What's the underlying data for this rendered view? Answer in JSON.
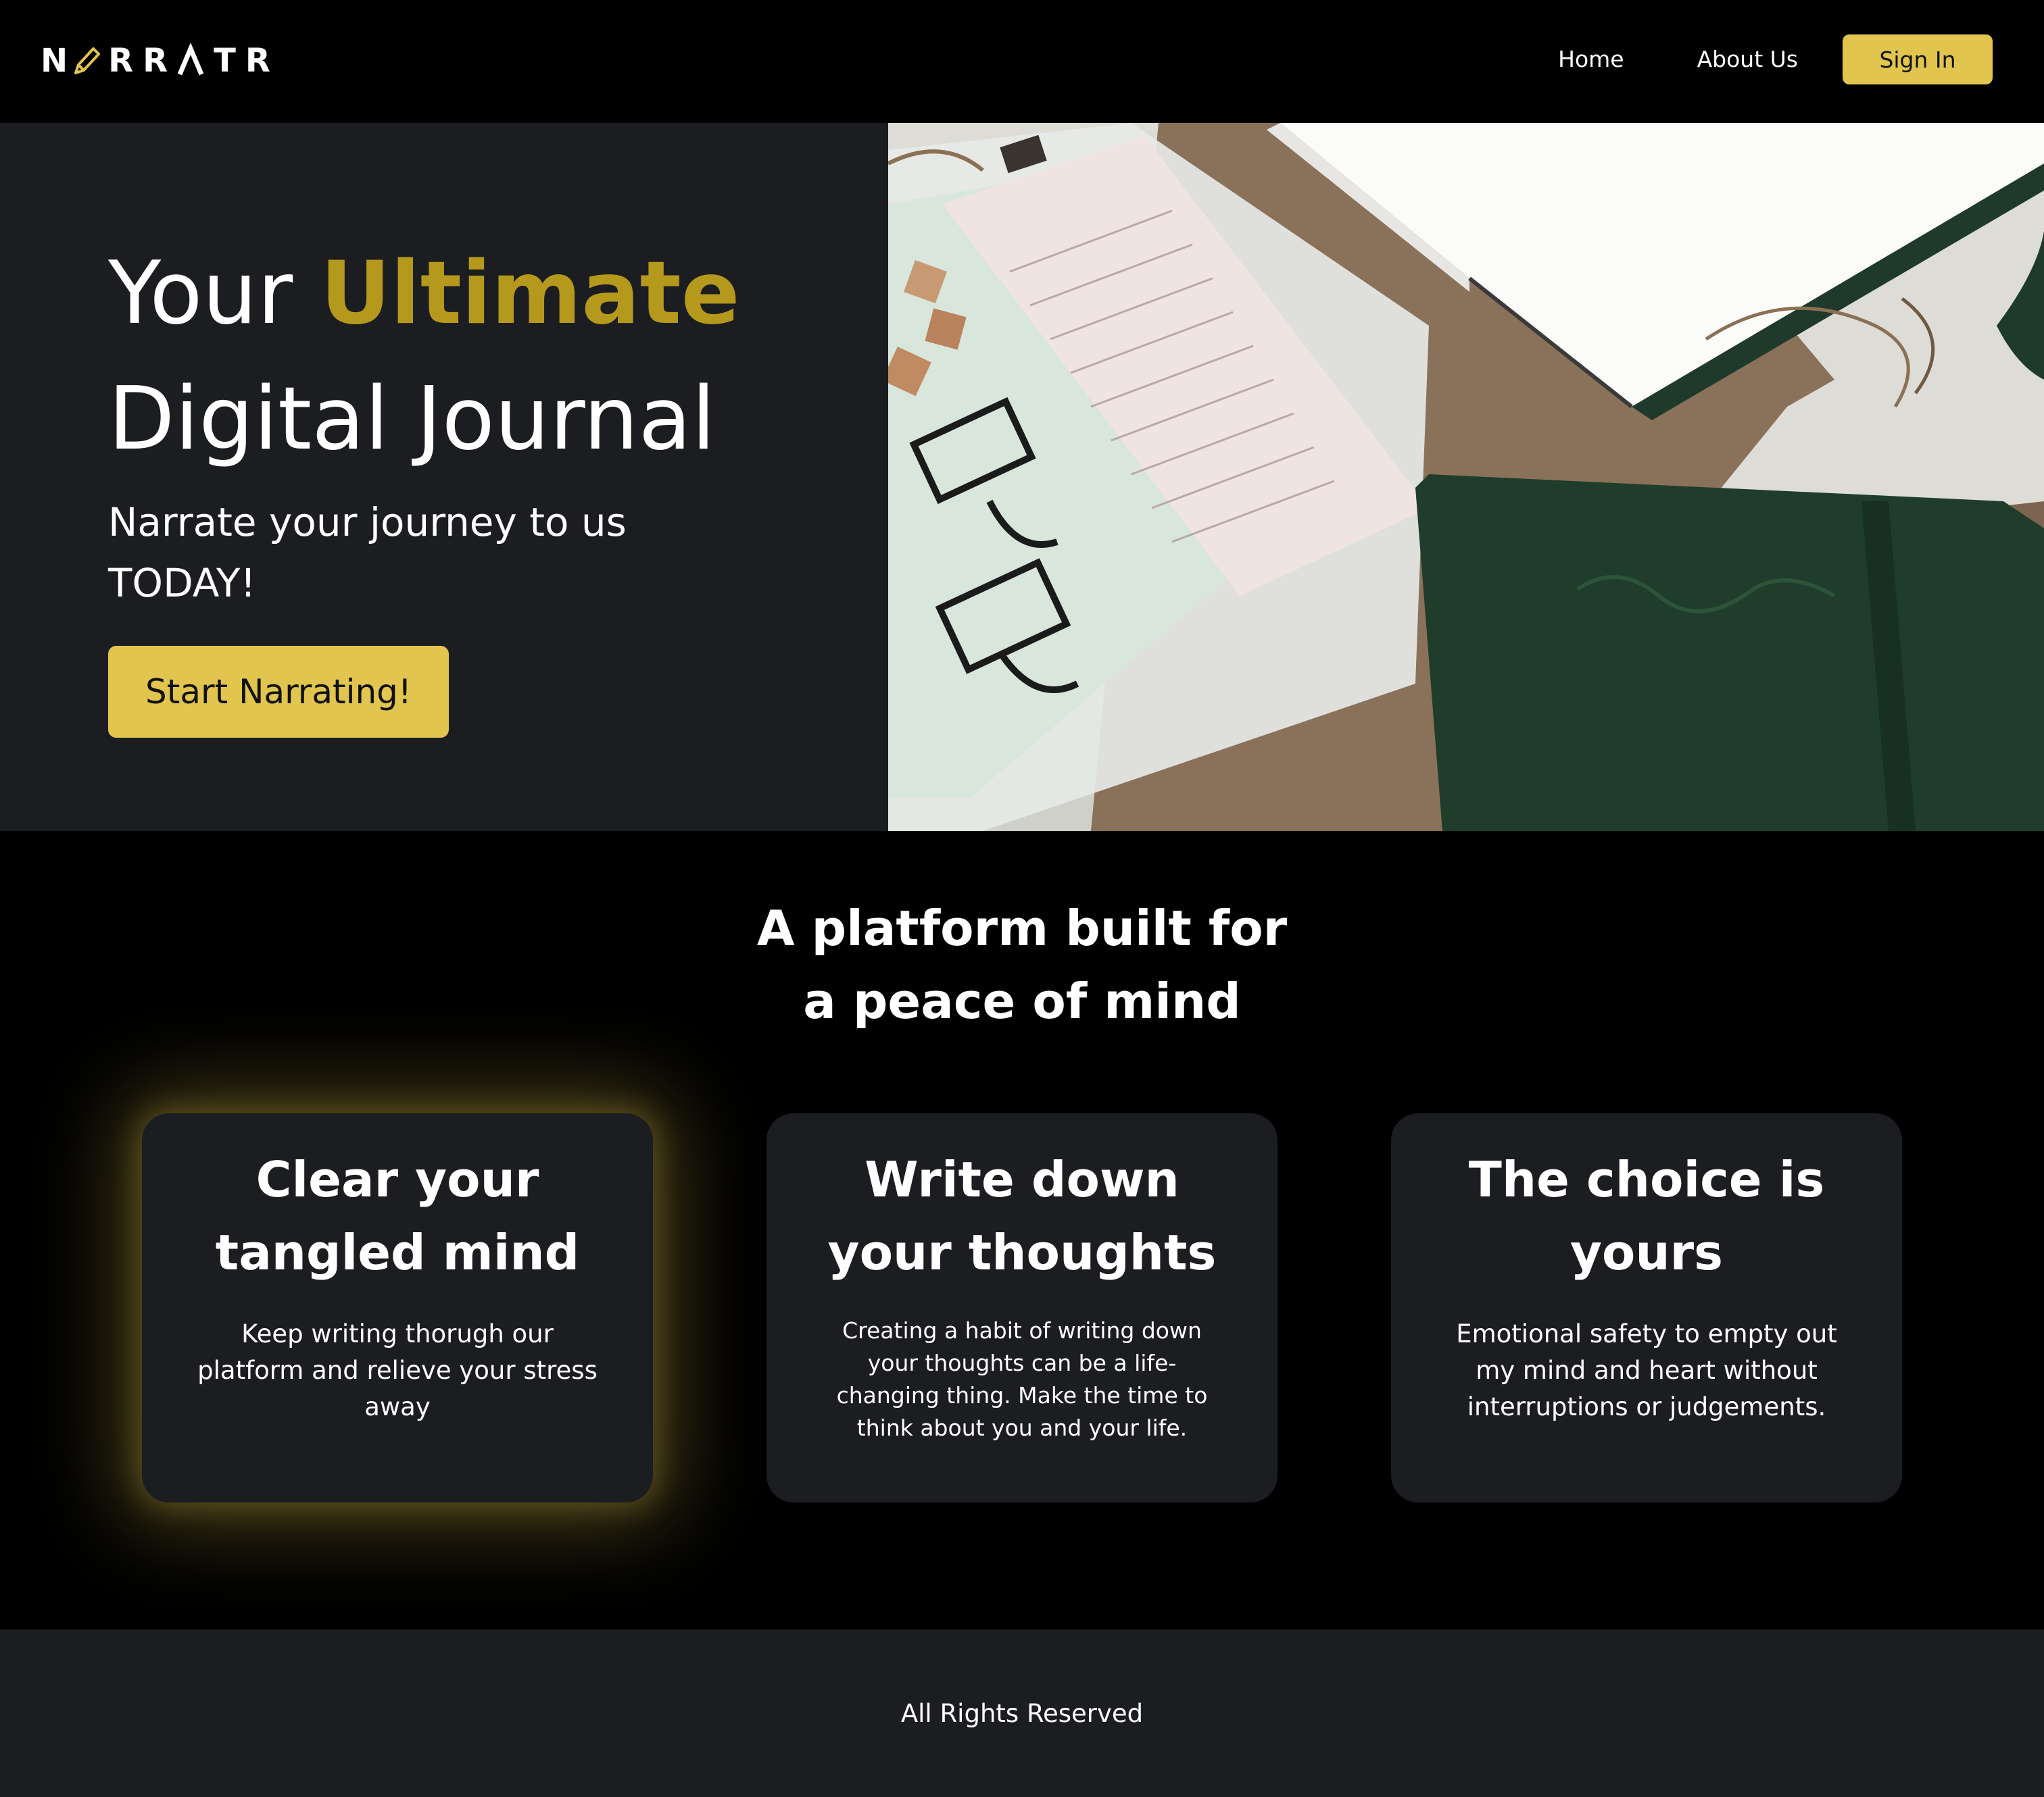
{
  "nav": {
    "logo_letters": [
      "N",
      "R",
      "R",
      "A",
      "T",
      "R"
    ],
    "logo_icon": "pencil-icon",
    "links": {
      "home": "Home",
      "about": "About Us"
    },
    "signin_label": "Sign In"
  },
  "hero": {
    "title_word1": "Your",
    "title_accent": "Ultimate",
    "title_line2": "Digital Journal",
    "subtitle": "Narrate your journey to us TODAY!",
    "cta_label": "Start Narrating!",
    "image_icon": "journal-desk-photo"
  },
  "features": {
    "title_line1": "A platform built for",
    "title_line2": "a peace of mind",
    "cards": [
      {
        "title_line1": "Clear your",
        "title_line2": "tangled mind",
        "text": "Keep writing thorugh our platform and relieve your stress away"
      },
      {
        "title_line1": "Write down",
        "title_line2": "your thoughts",
        "text": "Creating a habit of writing down your thoughts can be a life-changing thing. Make the time to think about you and your life."
      },
      {
        "title_line1": "The choice is",
        "title_line2": "yours",
        "text": "Emotional safety to empty out my mind and heart without interruptions or judgements."
      }
    ]
  },
  "footer": {
    "text": "All Rights Reserved"
  },
  "colors": {
    "accent": "#e2c54e",
    "title_accent": "#b4991d",
    "panel": "#1c1d20",
    "background": "#000000"
  }
}
